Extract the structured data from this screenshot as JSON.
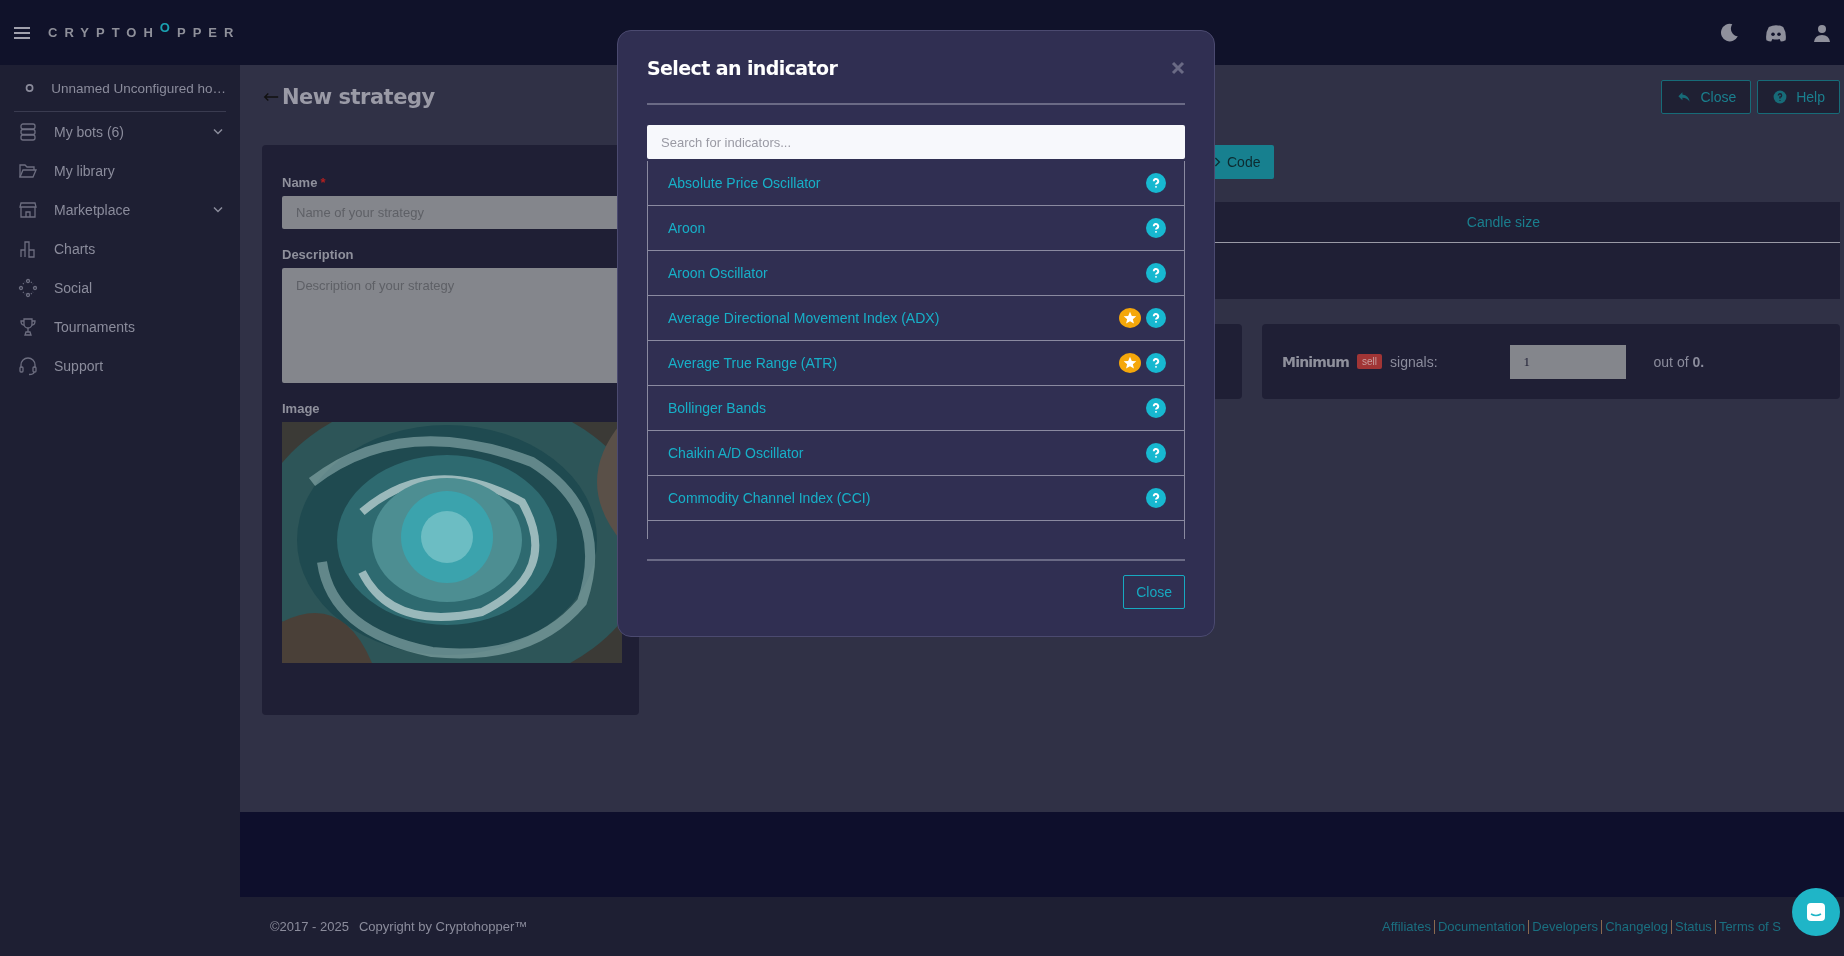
{
  "topbar": {
    "logo": [
      {
        "text": "CRYPTOH",
        "accent": false
      },
      {
        "text": "O",
        "accent": true
      },
      {
        "text": "PPER",
        "accent": false
      }
    ]
  },
  "sidebar": {
    "bot": "Unnamed Unconfigured ho…",
    "items": [
      {
        "label": "My bots (6)",
        "expandable": true
      },
      {
        "label": "My library",
        "expandable": false
      },
      {
        "label": "Marketplace",
        "expandable": true
      },
      {
        "label": "Charts",
        "expandable": false
      },
      {
        "label": "Social",
        "expandable": false
      },
      {
        "label": "Tournaments",
        "expandable": false
      },
      {
        "label": "Support",
        "expandable": false
      }
    ]
  },
  "page": {
    "title": "New strategy",
    "close_button": "Close",
    "help_button": "Help",
    "form": {
      "name_label": "Name",
      "required_mark": "*",
      "name_placeholder": "Name of your strategy",
      "description_label": "Description",
      "description_placeholder": "Description of your strategy",
      "image_label": "Image"
    },
    "code_button": "Code",
    "table": {
      "columns": [
        "Candle size"
      ]
    },
    "signals": {
      "label": "Minimum",
      "badge": "sell",
      "suffix": "signals:",
      "value": "1",
      "total": "out of **0.**"
    }
  },
  "modal": {
    "title": "Select an indicator",
    "search_placeholder": "Search for indicators...",
    "items": [
      {
        "label": "Absolute Price Oscillator",
        "starred": false
      },
      {
        "label": "Aroon",
        "starred": false
      },
      {
        "label": "Aroon Oscillator",
        "starred": false
      },
      {
        "label": "Average Directional Movement Index (ADX)",
        "starred": true
      },
      {
        "label": "Average True Range (ATR)",
        "starred": true
      },
      {
        "label": "Bollinger Bands",
        "starred": false
      },
      {
        "label": "Chaikin A/D Oscillator",
        "starred": false
      },
      {
        "label": "Commodity Channel Index (CCI)",
        "starred": false
      }
    ],
    "close_button": "Close"
  },
  "footer": {
    "years": "©2017 - 2025",
    "copyright": "Copyright by Cryptohopper™",
    "links": [
      "Affiliates",
      "Documentation",
      "Developers",
      "Changelog",
      "Status",
      "Terms of S"
    ]
  }
}
